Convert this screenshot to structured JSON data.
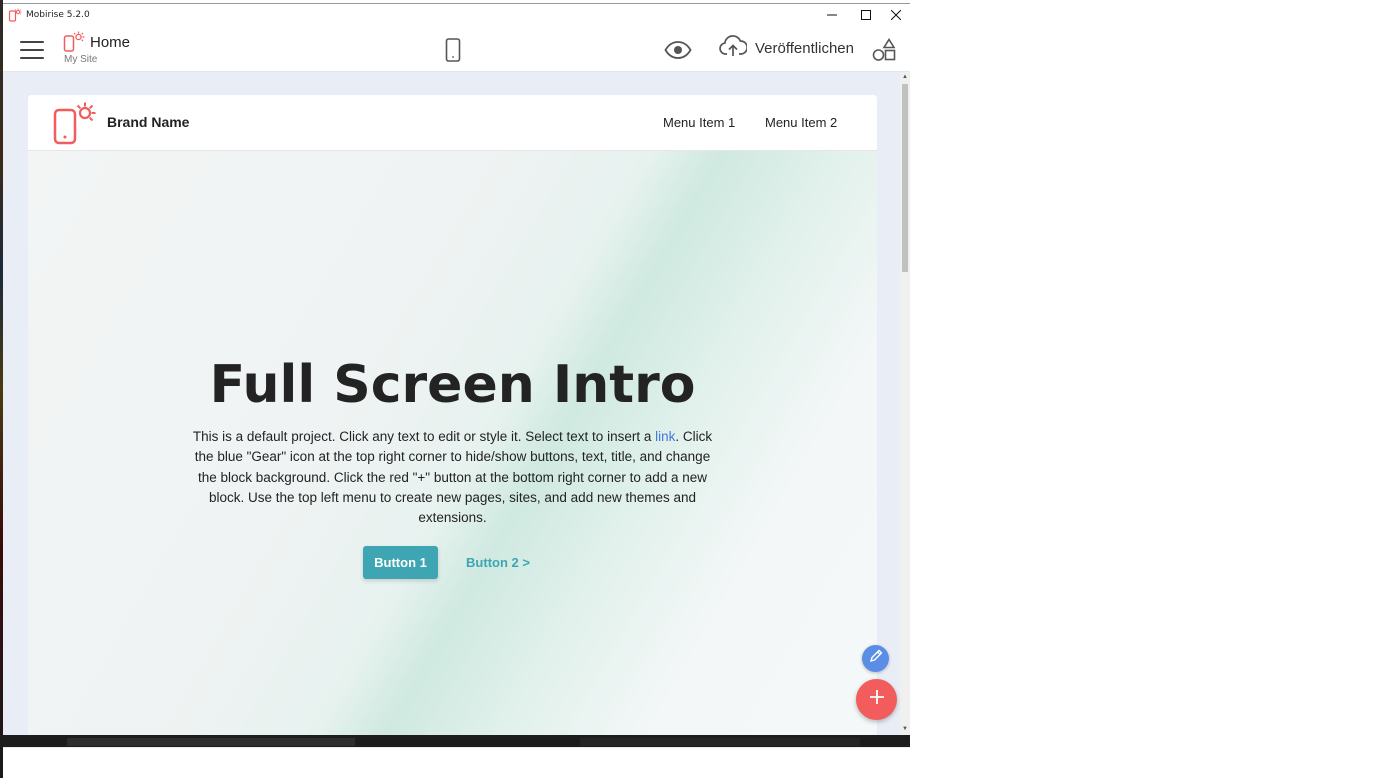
{
  "window": {
    "title": "Mobirise 5.2.0",
    "controls": {
      "minimize": "—",
      "maximize": "☐",
      "close": "✕"
    }
  },
  "toolbar": {
    "menu_icon": "hamburger-menu-icon",
    "page_name": "Home",
    "site_name": "My Site",
    "device_icon": "mobile-preview-icon",
    "preview_icon": "eye-icon",
    "publish_icon": "cloud-upload-icon",
    "publish_label": "Veröffentlichen",
    "blocks_icon": "shapes-icon"
  },
  "site": {
    "brand_name": "Brand Name",
    "menu": [
      "Menu Item 1",
      "Menu Item 2"
    ],
    "hero": {
      "title": "Full Screen Intro",
      "text_before_link": "This is a default project. Click any text to edit or style it. Select text to insert a ",
      "link_text": "link",
      "text_after_link": ". Click the blue \"Gear\" icon at the top right corner to hide/show buttons, text, title, and change the block background. Click the red \"+\" button at the bottom right corner to add a new block. Use the top left menu to create new pages, sites, and add new themes and extensions.",
      "button1": "Button 1",
      "button2": "Button 2 >"
    }
  },
  "fabs": {
    "edit_icon": "pencil-icon",
    "add_icon": "plus-icon"
  },
  "colors": {
    "accent_teal": "#3ea6b3",
    "brand_red": "#f25c5c",
    "edit_blue": "#5a8de6",
    "link_blue": "#4479d9"
  }
}
